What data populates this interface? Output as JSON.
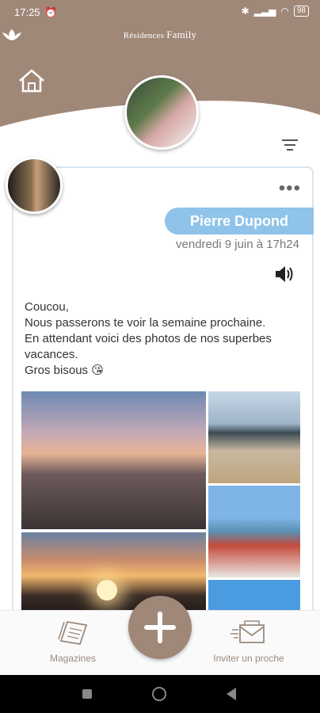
{
  "status_bar": {
    "time": "17:25",
    "alarm_icon": "alarm-icon",
    "battery": "98"
  },
  "header": {
    "brand_prefix": "Résidences",
    "brand_name": "Family",
    "bg_color": "#a08878",
    "home_icon": "home-icon",
    "filter_icon": "filter-icon"
  },
  "post": {
    "sender_name": "Pierre Dupond",
    "date": "vendredi 9 juin à 17h24",
    "more_icon": "more-dots-icon",
    "audio_icon": "speaker-icon",
    "message": "Coucou,\nNous passerons te voir la semaine prochaine.\nEn attendant voici des photos de nos superbes vacances.\nGros bisous 😘",
    "accent_color": "#8fc3e9"
  },
  "bottom_nav": {
    "magazines_label": "Magazines",
    "invite_label": "Inviter un proche",
    "add_icon": "plus-icon"
  }
}
